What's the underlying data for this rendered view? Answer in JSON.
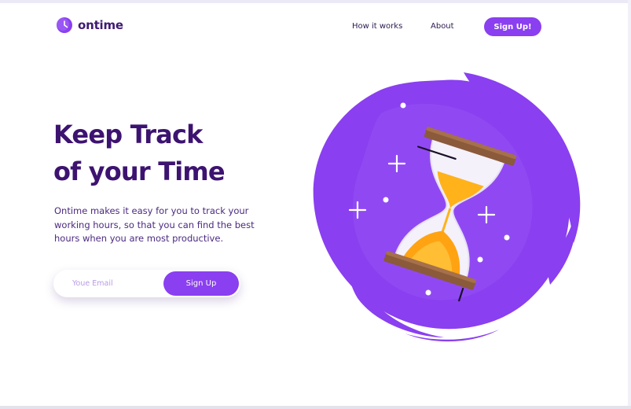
{
  "brand": {
    "name": "ontime",
    "logo_icon": "clock-icon",
    "accent_color": "#8a3ff0",
    "heading_color": "#3d1370"
  },
  "nav": {
    "links": [
      "How it works",
      "About"
    ],
    "cta_label": "Sign Up!"
  },
  "hero": {
    "title_lines": [
      "Keep Track",
      "of your Time"
    ],
    "description": "Ontime makes it easy for you to track your working hours, so that you can find the best hours when you are most productive."
  },
  "signup_form": {
    "email_placeholder": "Youe Email",
    "submit_label": "Sign Up"
  },
  "illustration": {
    "icon": "hourglass-icon",
    "blob_color": "#8a3ff0"
  }
}
